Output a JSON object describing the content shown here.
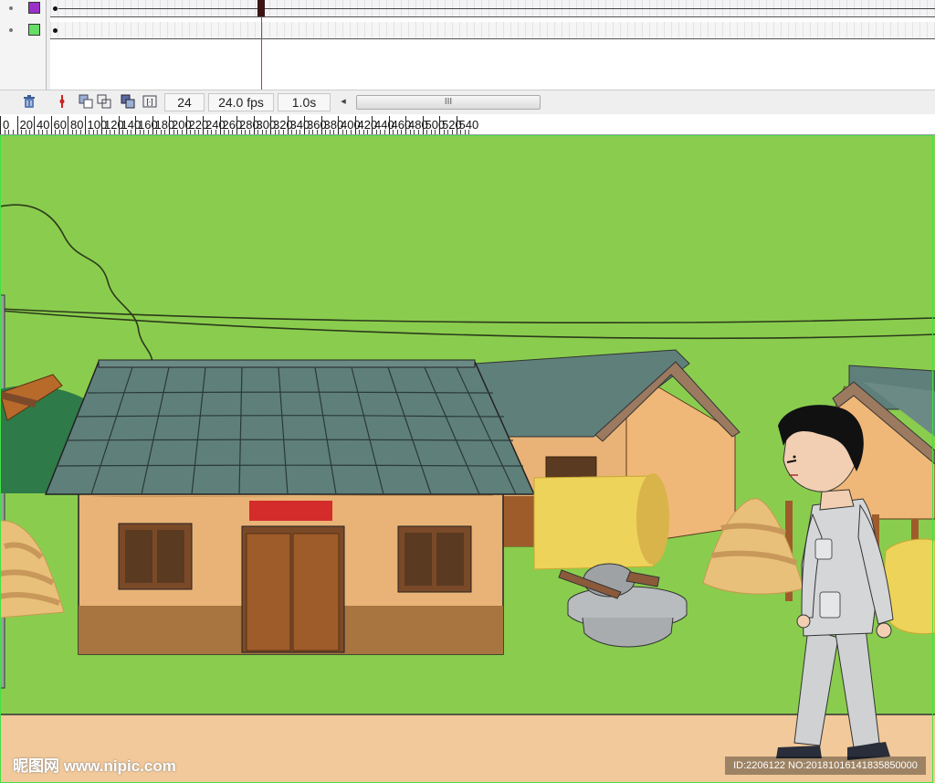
{
  "timeline": {
    "layers": [
      {
        "swatch_color": "#9b30c8"
      },
      {
        "swatch_color": "#66dd66"
      }
    ],
    "toolbar": {
      "delete_icon": "trash-icon",
      "frame": "24",
      "fps": "24.0 fps",
      "elapsed": "1.0s",
      "scroll_thumb": "III"
    }
  },
  "ruler": {
    "labels": [
      "0",
      "20",
      "40",
      "60",
      "80",
      "100",
      "120",
      "140",
      "160",
      "180",
      "200",
      "220",
      "240",
      "260",
      "280",
      "300",
      "320",
      "340",
      "360",
      "380",
      "400",
      "420",
      "440",
      "460",
      "480",
      "500",
      "520",
      "540"
    ]
  },
  "stage": {
    "colors": {
      "grass": "#8acd4e",
      "road": "#f2c99a",
      "roof": "#5f7f7a",
      "wall": "#e9b377",
      "door": "#9e5c2b",
      "banner": "#d42b2b",
      "hay": "#eed35a"
    }
  },
  "watermark": {
    "left": "昵图网 www.nipic.com",
    "right": "ID:2206122 NO:20181016141835850000"
  }
}
